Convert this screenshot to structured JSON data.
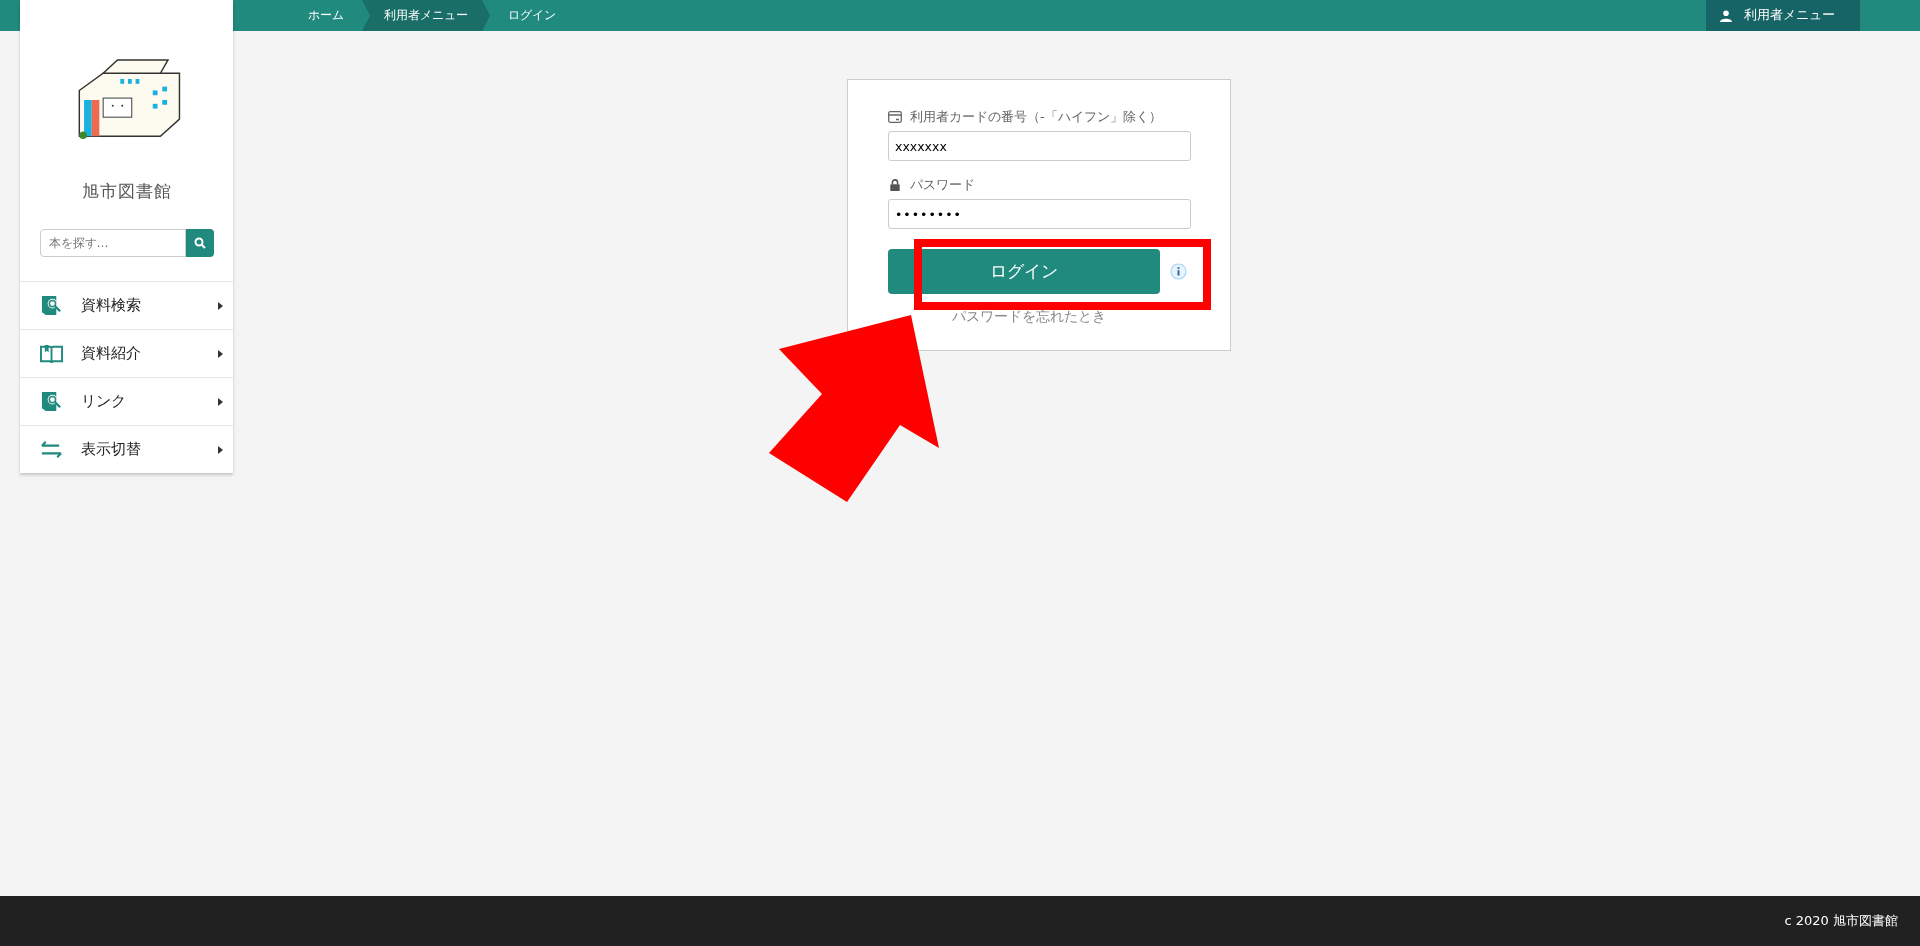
{
  "breadcrumb": [
    {
      "label": "ホーム",
      "selected": false
    },
    {
      "label": "利用者メニュー",
      "selected": true
    },
    {
      "label": "ログイン",
      "selected": false
    }
  ],
  "user_menu": {
    "label": "利用者メニュー"
  },
  "sidebar": {
    "title": "旭市図書館",
    "search": {
      "placeholder": "本を探す…"
    },
    "items": [
      {
        "kind": "search",
        "label": "資料検索"
      },
      {
        "kind": "book",
        "label": "資料紹介"
      },
      {
        "kind": "search",
        "label": "リンク"
      },
      {
        "kind": "swap",
        "label": "表示切替"
      }
    ]
  },
  "login": {
    "card_label": "利用者カードの番号（-「ハイフン」除く）",
    "card_value": "xxxxxxx",
    "password_label": "パスワード",
    "password_value": "••••••••",
    "button": "ログイン",
    "forgot_link": "パスワードを忘れたとき"
  },
  "footer": "c 2020 旭市図書館"
}
